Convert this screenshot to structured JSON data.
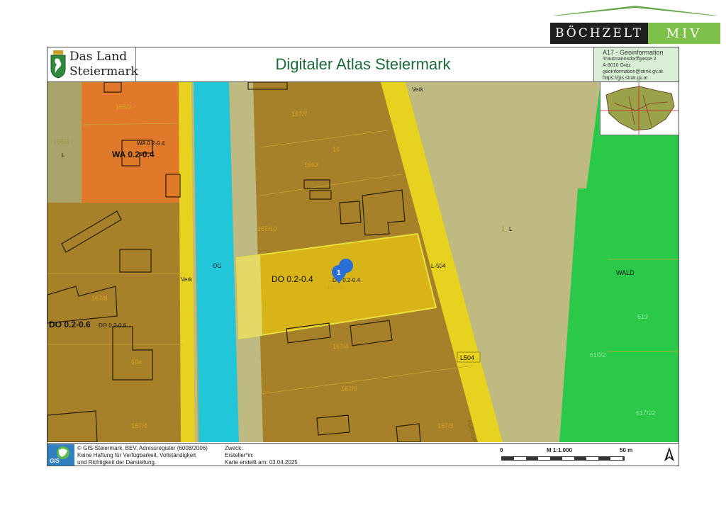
{
  "brand": {
    "name_left": "BÖCHZELT",
    "name_right": "MIV",
    "colors": {
      "dark": "#1e1e1e",
      "green": "#7dc14b"
    }
  },
  "header": {
    "logo_line1": "Das Land",
    "logo_line2": "Steiermark",
    "title": "Digitaler Atlas Steiermark",
    "agency": {
      "name": "A17 - Geoinformation",
      "street": "Trautmannsdorffgasse 2",
      "city": "A-8010 Graz",
      "email": "geoinformation@stmk.gv.at",
      "web": "https://gis.stmk.gv.at"
    }
  },
  "map": {
    "zoning": {
      "wa": "WA 0.2-0.4",
      "wa_small": "WA 0.2-0.4",
      "do_main": "DO 0.2-0.4",
      "do_main_small": "DO 0.2-0.4",
      "do_left": "DO 0.2-0.6",
      "do_left_small": "DO 0.2-0.6",
      "wald": "WALD",
      "l": "L"
    },
    "roads": {
      "verk_top": "Verk",
      "verk_left": "Verk",
      "l504": "L-504",
      "l504_badge": "L504",
      "og": "ÖG",
      "street": "Hofbauergasse"
    },
    "parcels": [
      "165/2",
      "166/3",
      "167/7",
      "1662",
      "16",
      "167/10",
      "167/8",
      "10a",
      "167/4",
      "167/9",
      "157/4",
      "167/3",
      "610/2",
      "619",
      "617/22",
      "167/1",
      "1"
    ],
    "marker": "1",
    "colors": {
      "orange": "#e07a2a",
      "brown": "#b88a25",
      "yellow": "#e6d21f",
      "cyan": "#21c7d9",
      "green": "#2bc94a",
      "khaki": "#bfba82",
      "plot": "#d4b21a"
    }
  },
  "footer": {
    "copyright": "© GIS-Steiermark, BEV, Adressregister (6008/2006)",
    "disclaimer1": "Keine Haftung für Verfügbarkeit, Vollständigkeit",
    "disclaimer2": "und Richtigkeit der Darstellung.",
    "purpose": "Zweck:",
    "creator": "Ersteller*in:",
    "created": "Karte erstellt am: 03.04.2025",
    "scale_start": "0",
    "scale": "M 1:1.000",
    "scale_end": "50 m",
    "gis_label": "GIS"
  }
}
